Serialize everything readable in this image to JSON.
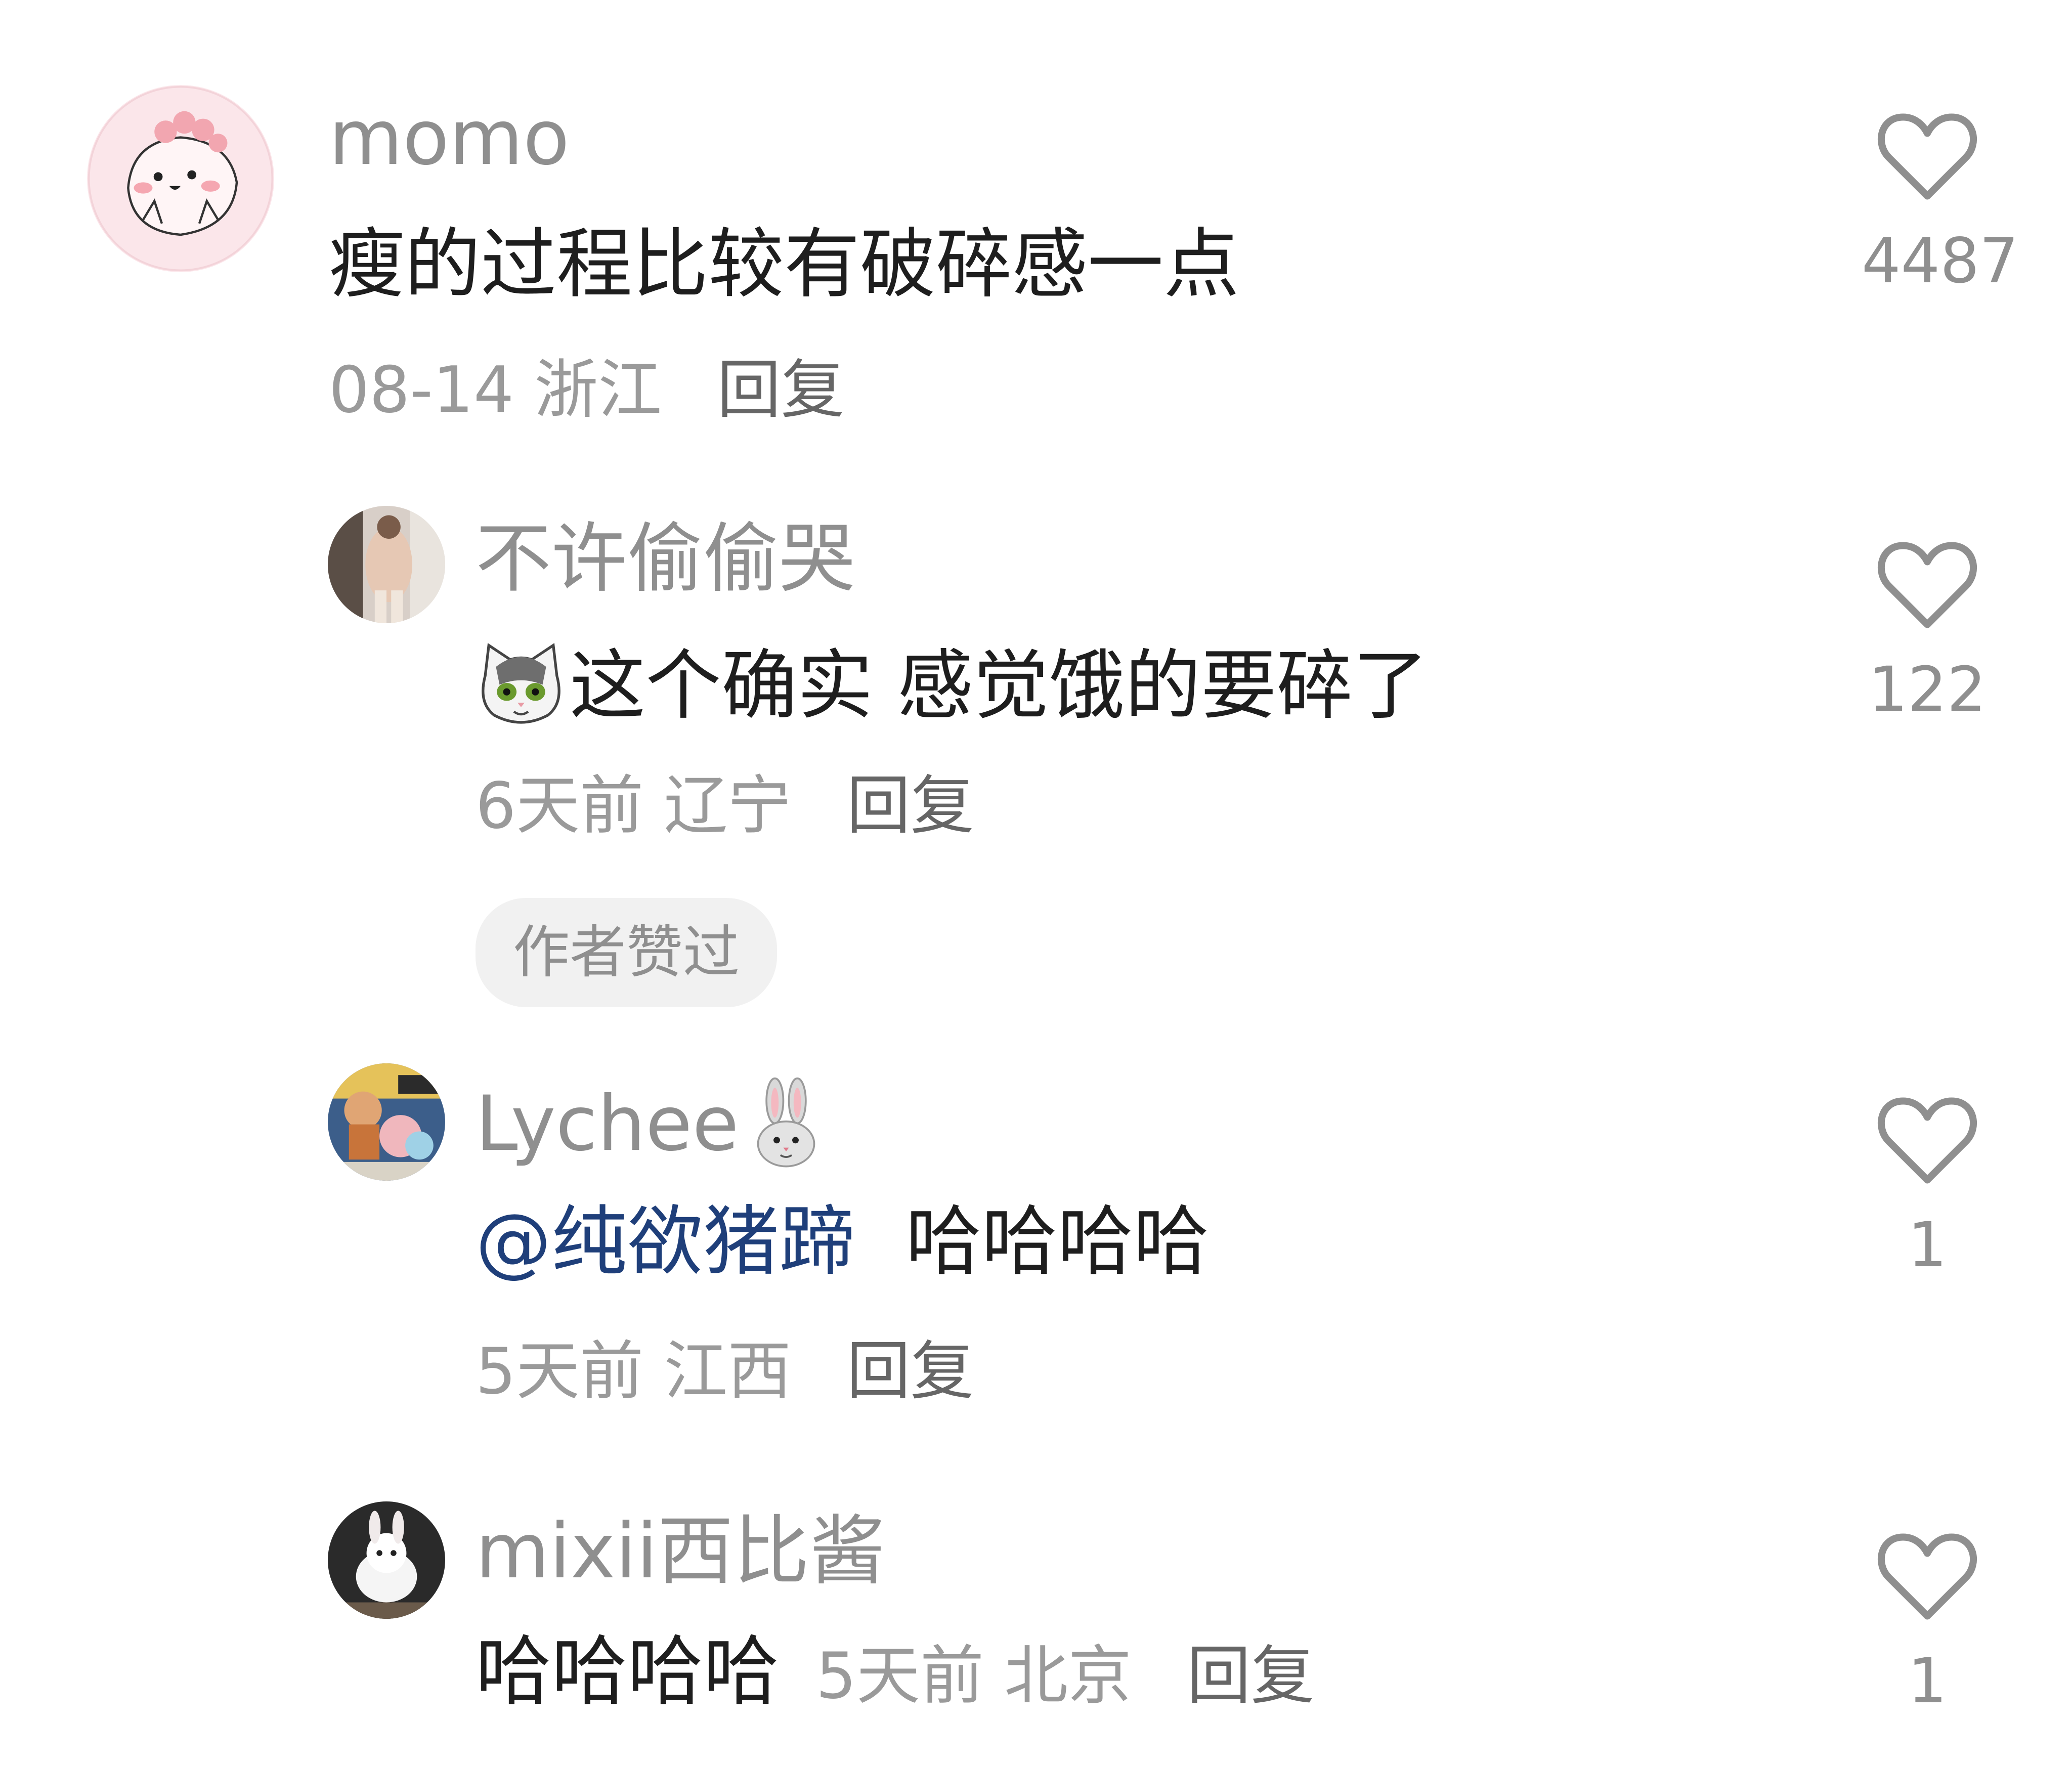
{
  "comments": [
    {
      "username": "momo",
      "text": "瘦的过程比较有破碎感一点",
      "date": "08-14",
      "location": "浙江",
      "reply_label": "回复",
      "like_count": "4487"
    },
    {
      "username": "不许偷偷哭",
      "text": "这个确实 感觉饿的要碎了",
      "date": "6天前",
      "location": "辽宁",
      "reply_label": "回复",
      "badge": "作者赞过",
      "like_count": "122"
    },
    {
      "username": "Lychee",
      "mention": "@纯欲猪蹄",
      "text": "哈哈哈哈",
      "date": "5天前",
      "location": "江西",
      "reply_label": "回复",
      "like_count": "1"
    },
    {
      "username": "mixii西比酱",
      "text": "哈哈哈哈",
      "date": "5天前",
      "location": "北京",
      "reply_label": "回复",
      "like_count": "1"
    }
  ],
  "icons": {
    "like": "heart-outline-icon",
    "emoji_cat": "cat-emoji-icon",
    "emoji_rabbit": "rabbit-emoji-icon"
  },
  "colors": {
    "username": "#8f8f8f",
    "text": "#1e1e1e",
    "meta": "#9a9a9a",
    "mention": "#1f3f7a",
    "badge_bg": "#f1f1f1",
    "heart": "#8f8f8f"
  }
}
